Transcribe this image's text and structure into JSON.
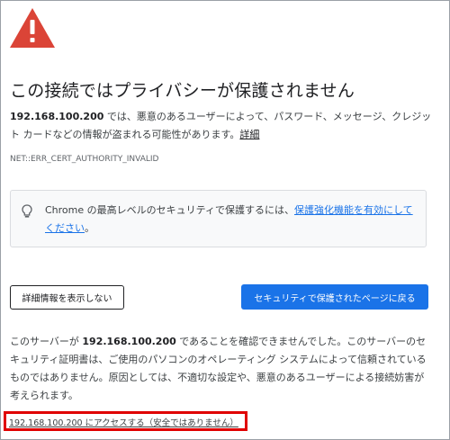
{
  "page": {
    "title": "この接続ではプライバシーが保護されません",
    "main_host": "192.168.100.200",
    "main_message": " では、悪意のあるユーザーによって、パスワード、メッセージ、クレジット カードなどの情報が盗まれる可能性があります。",
    "learn_more": "詳細",
    "error_code": "NET::ERR_CERT_AUTHORITY_INVALID"
  },
  "enhanced": {
    "text": "Chrome の最高レベルのセキュリティで保護するには、",
    "link": "保護強化機能を有効にしてください",
    "suffix": "。"
  },
  "buttons": {
    "details": "詳細情報を表示しない",
    "back": "セキュリティで保護されたページに戻る"
  },
  "details": {
    "prefix": "このサーバーが ",
    "host": "192.168.100.200",
    "text": " であることを確認できませんでした。このサーバーのセキュリティ証明書は、ご使用のパソコンのオペレーティング システムによって信頼されているものではありません。原因としては、不適切な設定や、悪意のあるユーザーによる接続妨害が考えられます。"
  },
  "proceed": {
    "link": "192.168.100.200 にアクセスする（安全ではありません）"
  },
  "colors": {
    "warning_red": "#db4437",
    "button_blue": "#1a73e8",
    "highlight_red": "#e00000"
  },
  "icons": {
    "warning": "warning-triangle-icon",
    "bulb": "lightbulb-icon"
  }
}
